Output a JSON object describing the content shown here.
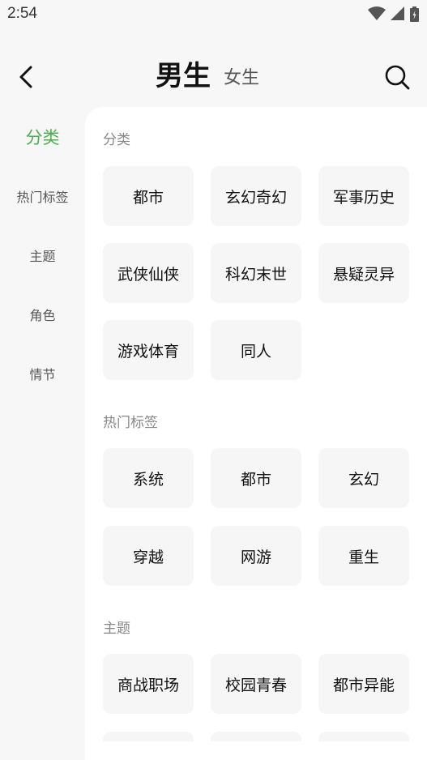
{
  "status_bar": {
    "time": "2:54"
  },
  "header": {
    "tab_active": "男生",
    "tab_inactive": "女生"
  },
  "left_nav": [
    {
      "label": "分类",
      "active": true
    },
    {
      "label": "热门标签",
      "active": false
    },
    {
      "label": "主题",
      "active": false
    },
    {
      "label": "角色",
      "active": false
    },
    {
      "label": "情节",
      "active": false
    }
  ],
  "sections": {
    "category": {
      "title": "分类",
      "items": [
        "都市",
        "玄幻奇幻",
        "军事历史",
        "武侠仙侠",
        "科幻末世",
        "悬疑灵异",
        "游戏体育",
        "同人"
      ]
    },
    "hot_tags": {
      "title": "热门标签",
      "items": [
        "系统",
        "都市",
        "玄幻",
        "穿越",
        "网游",
        "重生"
      ]
    },
    "theme": {
      "title": "主题",
      "items": [
        "商战职场",
        "校园青春",
        "都市异能"
      ]
    }
  },
  "colors": {
    "accent": "#4cae4c"
  }
}
